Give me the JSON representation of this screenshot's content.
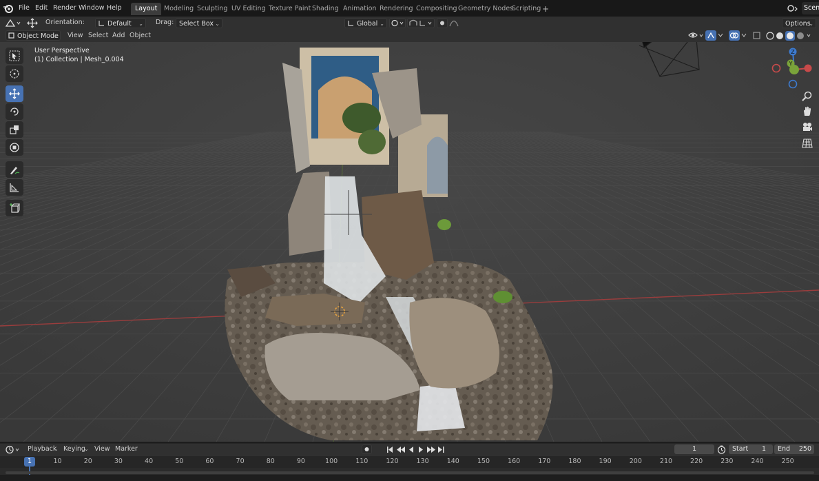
{
  "menu": {
    "items": [
      "File",
      "Edit",
      "Render",
      "Window",
      "Help"
    ]
  },
  "workspaces": {
    "tabs": [
      "Layout",
      "Modeling",
      "Sculpting",
      "UV Editing",
      "Texture Paint",
      "Shading",
      "Animation",
      "Rendering",
      "Compositing",
      "Geometry Nodes",
      "Scripting"
    ],
    "active": "Layout",
    "add": "+"
  },
  "scene": {
    "label": "Scen"
  },
  "toolbar": {
    "orientation_label": "Orientation:",
    "orientation_value": "Default",
    "drag_label": "Drag:",
    "drag_value": "Select Box",
    "transform_space": "Global",
    "options_label": "Options"
  },
  "view_header": {
    "mode": "Object Mode",
    "menus": [
      "View",
      "Select",
      "Add",
      "Object"
    ]
  },
  "viewport": {
    "perspective_label": "User Perspective",
    "collection_label": "(1) Collection | Mesh_0.004",
    "axis_labels": {
      "z": "Z",
      "y": "Y"
    }
  },
  "tools": [
    "select-box",
    "cursor",
    "move",
    "rotate",
    "scale",
    "transform",
    "annotate",
    "measure",
    "add-cube"
  ],
  "timeline": {
    "menus": [
      "Playback",
      "Keying",
      "View",
      "Marker"
    ],
    "current_frame": "1",
    "start_label": "Start",
    "start_value": "1",
    "end_label": "End",
    "end_value": "250",
    "ticks": [
      "1",
      "10",
      "20",
      "30",
      "40",
      "50",
      "60",
      "70",
      "80",
      "90",
      "100",
      "110",
      "120",
      "130",
      "140",
      "150",
      "160",
      "170",
      "180",
      "190",
      "200",
      "210",
      "220",
      "230",
      "240",
      "250"
    ],
    "playhead_frame": "1"
  },
  "colors": {
    "accent": "#4772b3",
    "x_axis": "#c84a4a",
    "y_axis": "#7aa33a",
    "z_axis": "#3d7bd0"
  }
}
